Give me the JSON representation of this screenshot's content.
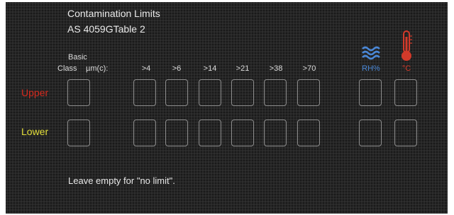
{
  "header": {
    "title": "Contamination Limits",
    "subtitle": "AS 4059GTable 2"
  },
  "columns": {
    "basic_class_line1": "Basic",
    "basic_class_line2": "Class",
    "micron_label": "µm(c):",
    "sizes": [
      ">4",
      ">6",
      ">14",
      ">21",
      ">38",
      ">70"
    ],
    "rh_label": "RH%",
    "temp_label": "°C"
  },
  "rows": {
    "upper_label": "Upper",
    "lower_label": "Lower"
  },
  "footer": {
    "hint": "Leave empty for \"no limit\"."
  },
  "icons": {
    "humidity": "water-waves-icon",
    "temperature": "thermometer-icon"
  },
  "colors": {
    "upper": "#d42a1e",
    "lower": "#e3de3a",
    "humidity": "#4a87d6",
    "temperature": "#d33a2a"
  }
}
